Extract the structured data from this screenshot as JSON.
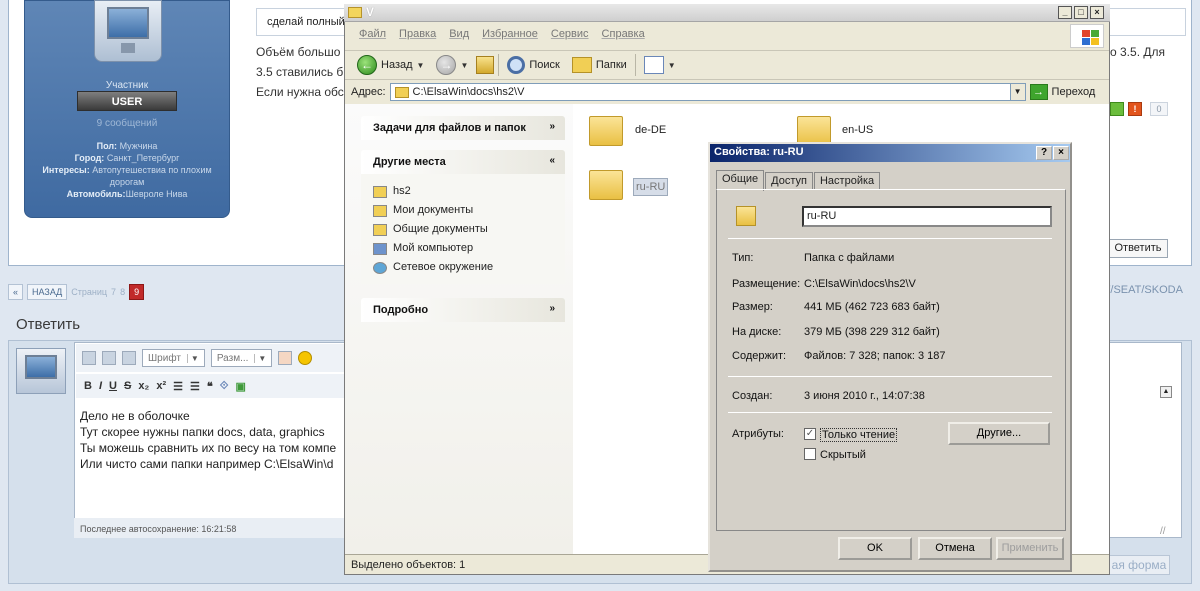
{
  "forum": {
    "quote_text": "сделай полный а",
    "post_lines": [
      "Объём большо",
      "3.5 ставились б",
      "Если нужна обс"
    ],
    "post_right": [
      "о 3.5. Для"
    ],
    "user": {
      "role": "Участник",
      "badge": "USER",
      "messages": "9 сообщений",
      "info": [
        {
          "k": "Пол:",
          "v": "Мужчина"
        },
        {
          "k": "Город:",
          "v": "Санкт_Петербург"
        },
        {
          "k": "Интересы:",
          "v": "Автопутешествиа по плохим дорогам"
        },
        {
          "k": "Автомобиль:",
          "v": "Шевроле Нива"
        }
      ]
    },
    "vote_minus": "!",
    "vote_count": "0",
    "reply_button": "Ответить",
    "pager": {
      "prev": "«",
      "back": "НАЗАД",
      "pages_label": "Страниц",
      "pages": [
        "7",
        "8"
      ],
      "current": "9"
    },
    "crumb_right": "W/SEAT/SKODA",
    "reply_title": "Ответить",
    "editor": {
      "font_select": "Шрифт",
      "size_select": "Разм...",
      "format_buttons": [
        "B",
        "I",
        "U",
        "S",
        "x₂",
        "x²",
        "☰",
        "☰",
        "❝",
        "⟐",
        "▣"
      ],
      "lines": [
        "Дело не в оболочке",
        "Тут скорее  нужны папки  docs, data, graphics",
        "Ты можешь сравнить их по весу на том компе",
        "Или чисто сами папки  например C:\\ElsaWin\\d"
      ],
      "autosave": "Последнее автосохранение: 16:21:58"
    },
    "advanced_form": "ая форма"
  },
  "explorer": {
    "title": "V",
    "menu": [
      "Файл",
      "Правка",
      "Вид",
      "Избранное",
      "Сервис",
      "Справка"
    ],
    "toolbar": {
      "back": "Назад",
      "search": "Поиск",
      "folders": "Папки"
    },
    "address_label": "Адрес:",
    "address": "C:\\ElsaWin\\docs\\hs2\\V",
    "go": "Переход",
    "taskpane": {
      "tasks_header": "Задачи для файлов и папок",
      "places_header": "Другие места",
      "places": [
        "hs2",
        "Мои документы",
        "Общие документы",
        "Мой компьютер",
        "Сетевое окружение"
      ],
      "details_header": "Подробно"
    },
    "folders": [
      "de-DE",
      "en-US",
      "ru-RU"
    ],
    "status": "Выделено объектов: 1"
  },
  "properties": {
    "title": "Свойства: ru-RU",
    "tabs": [
      "Общие",
      "Доступ",
      "Настройка"
    ],
    "name": "ru-RU",
    "rows": [
      {
        "label": "Тип:",
        "value": "Папка с файлами"
      },
      {
        "label": "Размещение:",
        "value": "C:\\ElsaWin\\docs\\hs2\\V"
      },
      {
        "label": "Размер:",
        "value": "441 МБ (462 723 683 байт)"
      },
      {
        "label": "На диске:",
        "value": "379 МБ (398 229 312 байт)"
      },
      {
        "label": "Содержит:",
        "value": "Файлов: 7 328; папок: 3 187"
      }
    ],
    "created_label": "Создан:",
    "created": "3 июня 2010 г., 14:07:38",
    "attributes_label": "Атрибуты:",
    "readonly": "Только чтение",
    "hidden": "Скрытый",
    "other_button": "Другие...",
    "ok": "OK",
    "cancel": "Отмена",
    "apply": "Применить"
  }
}
